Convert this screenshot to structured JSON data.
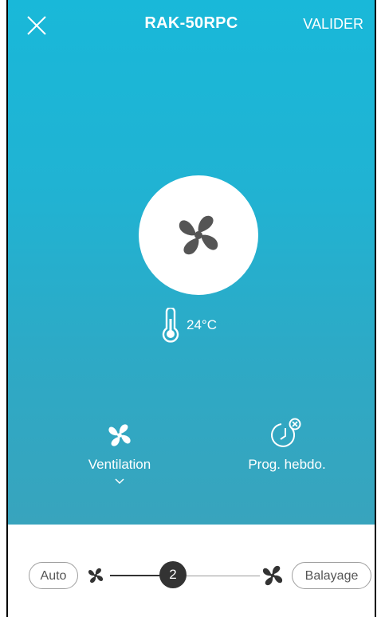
{
  "header": {
    "title": "RAK-50RPC",
    "validate_label": "VALIDER"
  },
  "status": {
    "mode_icon": "fan-icon",
    "temperature": "24°C"
  },
  "controls": {
    "mode_label": "Ventilation",
    "schedule_label": "Prog. hebdo."
  },
  "fan_speed": {
    "auto_label": "Auto",
    "value": "2",
    "swing_label": "Balayage",
    "level_fraction": 0.45
  },
  "colors": {
    "gradient_top": "#19b8d9",
    "gradient_bottom": "#38a4bd",
    "icon_dark": "#555555",
    "knob": "#333333"
  }
}
